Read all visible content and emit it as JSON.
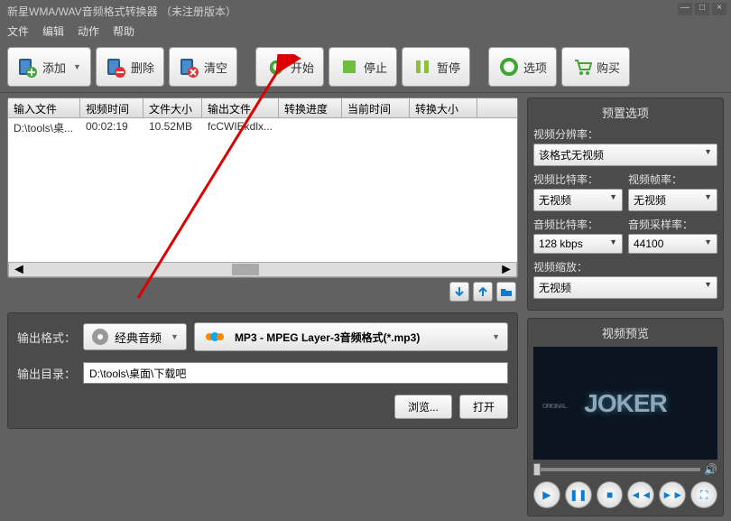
{
  "app": {
    "title": "新星WMA/WAV音频格式转换器 （未注册版本）"
  },
  "menu": {
    "file": "文件",
    "edit": "编辑",
    "action": "动作",
    "help": "帮助"
  },
  "toolbar": {
    "add": "添加",
    "delete": "删除",
    "clear": "清空",
    "start": "开始",
    "stop": "停止",
    "pause": "暂停",
    "options": "选项",
    "buy": "购买"
  },
  "grid": {
    "headers": {
      "input": "输入文件",
      "vtime": "视频时间",
      "fsize": "文件大小",
      "output": "输出文件",
      "prog": "转换进度",
      "ctime": "当前时间",
      "csize": "转换大小"
    },
    "row": {
      "input": "D:\\tools\\桌...",
      "vtime": "00:02:19",
      "fsize": "10.52MB",
      "output": "fcCWIEkdlx...",
      "prog": "",
      "ctime": "",
      "csize": ""
    }
  },
  "output": {
    "format_label": "输出格式：",
    "cat": "经典音频",
    "format": "MP3 - MPEG Layer-3音频格式(*.mp3)",
    "dir_label": "输出目录：",
    "dir": "D:\\tools\\桌面\\下载吧",
    "browse": "浏览...",
    "open": "打开"
  },
  "preset": {
    "title": "预置选项",
    "vres": {
      "label": "视频分辨率：",
      "value": "该格式无视频"
    },
    "vbit": {
      "label": "视频比特率：",
      "value": "无视频"
    },
    "vfps": {
      "label": "视频帧率：",
      "value": "无视频"
    },
    "abit": {
      "label": "音频比特率：",
      "value": "128 kbps"
    },
    "asamp": {
      "label": "音频采样率：",
      "value": "44100"
    },
    "vzoom": {
      "label": "视频缩放：",
      "value": "无视频"
    }
  },
  "preview": {
    "title": "视频预览",
    "text": "JOKER",
    "ori": "ORIGINAL"
  }
}
